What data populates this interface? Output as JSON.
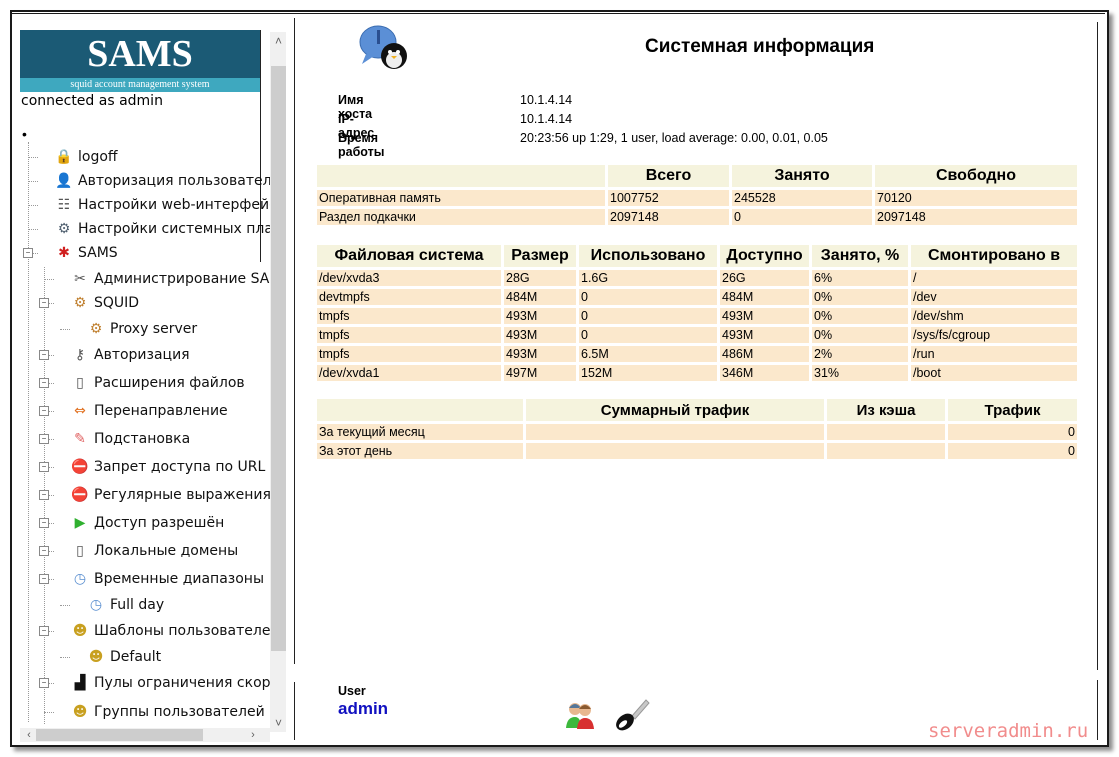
{
  "sidebar": {
    "logo_title": "SAMS",
    "logo_subtitle": "squid account management system",
    "connected_text": "connected as admin",
    "root_marker": "•",
    "items": [
      {
        "label": "logoff",
        "icon": "lock-icon"
      },
      {
        "label": "Авторизация пользователя",
        "icon": "user-auth-icon"
      },
      {
        "label": "Настройки web-интерфейса",
        "icon": "web-settings-icon"
      },
      {
        "label": "Настройки системных плагинов",
        "icon": "plugins-gear-icon"
      },
      {
        "label": "SAMS",
        "icon": "sams-icon"
      },
      {
        "label": "Администрирование SAMS",
        "icon": "tools-icon"
      },
      {
        "label": "SQUID",
        "icon": "squid-gear-icon"
      },
      {
        "label": "Proxy server",
        "icon": "proxy-gear-icon"
      },
      {
        "label": "Авторизация",
        "icon": "auth-keys-icon"
      },
      {
        "label": "Расширения файлов",
        "icon": "document-icon"
      },
      {
        "label": "Перенаправление",
        "icon": "redirect-icon"
      },
      {
        "label": "Подстановка",
        "icon": "substitution-icon"
      },
      {
        "label": "Запрет доступа по URL",
        "icon": "deny-url-icon"
      },
      {
        "label": "Регулярные выражения",
        "icon": "regex-deny-icon"
      },
      {
        "label": "Доступ разрешён",
        "icon": "allow-access-icon"
      },
      {
        "label": "Локальные домены",
        "icon": "document-icon"
      },
      {
        "label": "Временные диапазоны",
        "icon": "clock-icon"
      },
      {
        "label": "Full day",
        "icon": "clock-icon"
      },
      {
        "label": "Шаблоны пользователей",
        "icon": "user-template-icon"
      },
      {
        "label": "Default",
        "icon": "user-template-icon"
      },
      {
        "label": "Пулы ограничения скорости",
        "icon": "speed-chart-icon"
      },
      {
        "label": "Группы пользователей",
        "icon": "user-group-icon"
      }
    ]
  },
  "main": {
    "title": "Системная информация",
    "info": [
      {
        "label": "Имя хоста",
        "value": "10.1.4.14"
      },
      {
        "label": "IP-адрес",
        "value": "10.1.4.14"
      },
      {
        "label": "Время работы",
        "value": "20:23:56 up 1:29, 1 user, load average: 0.00, 0.01, 0.05"
      }
    ],
    "memory": {
      "headers": [
        "",
        "Всего",
        "Занято",
        "Свободно"
      ],
      "rows": [
        [
          "Оперативная память",
          "1007752",
          "245528",
          "70120"
        ],
        [
          "Раздел подкачки",
          "2097148",
          "0",
          "2097148"
        ]
      ]
    },
    "filesystems": {
      "headers": [
        "Файловая система",
        "Размер",
        "Использовано",
        "Доступно",
        "Занято, %",
        "Смонтировано в"
      ],
      "rows": [
        [
          "/dev/xvda3",
          "28G",
          "1.6G",
          "26G",
          "6%",
          "/"
        ],
        [
          "devtmpfs",
          "484M",
          "0",
          "484M",
          "0%",
          "/dev"
        ],
        [
          "tmpfs",
          "493M",
          "0",
          "493M",
          "0%",
          "/dev/shm"
        ],
        [
          "tmpfs",
          "493M",
          "0",
          "493M",
          "0%",
          "/sys/fs/cgroup"
        ],
        [
          "tmpfs",
          "493M",
          "6.5M",
          "486M",
          "2%",
          "/run"
        ],
        [
          "/dev/xvda1",
          "497M",
          "152M",
          "346M",
          "31%",
          "/boot"
        ]
      ]
    },
    "traffic": {
      "headers": [
        "",
        "Суммарный трафик",
        "Из кэша",
        "Трафик"
      ],
      "rows": [
        [
          "За текущий месяц",
          "",
          "",
          "0"
        ],
        [
          "За этот день",
          "",
          "",
          "0"
        ]
      ]
    }
  },
  "footer": {
    "user_label": "User",
    "user_name": "admin",
    "watermark": "serveradmin.ru"
  },
  "colors": {
    "logo_bg": "#1b5a75",
    "logo_sub_bg": "#3ea8bf",
    "table_header_bg": "#f5f3dd",
    "table_cell_bg": "#fbe8cc",
    "user_name": "#1010c0",
    "watermark": "#f08080"
  }
}
